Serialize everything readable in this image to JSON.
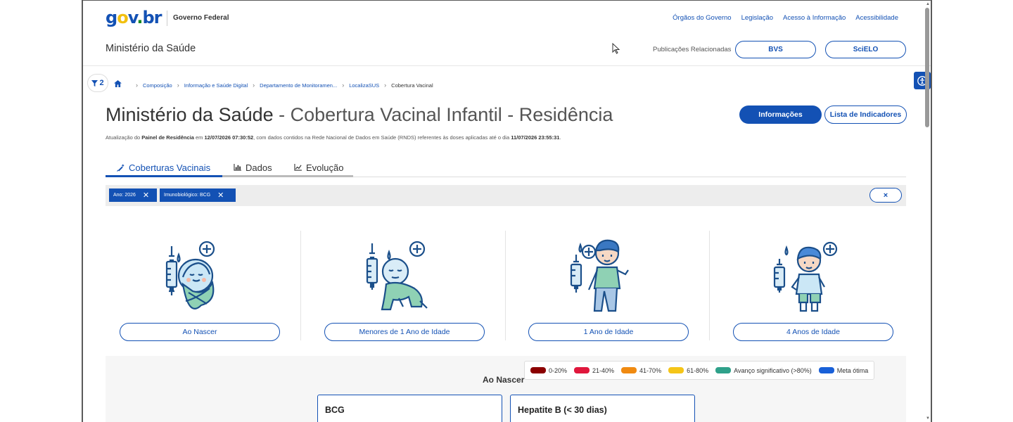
{
  "header": {
    "logo": {
      "g": "g",
      "o": "o",
      "v": "v",
      "dot": ".",
      "br": "br"
    },
    "gov_federal": "Governo Federal",
    "links": [
      "Órgãos do Governo",
      "Legislação",
      "Acesso à Informação",
      "Acessibilidade"
    ],
    "ministry": "Ministério da Saúde",
    "pub_label": "Publicações Relacionadas",
    "pill_bvs": "BVS",
    "pill_scielo": "SciELO"
  },
  "filter_badge": {
    "count": "2"
  },
  "breadcrumb": [
    "Composição",
    "Informação e Saúde Digital",
    "Departamento de Monitoramen...",
    "LocalizaSUS",
    "Cobertura Vacinal"
  ],
  "title": {
    "main": "Ministério da Saúde",
    "rest": " - Cobertura Vacinal Infantil - Residência"
  },
  "buttons": {
    "info": "Informações",
    "indicators": "Lista de Indicadores"
  },
  "update": {
    "p1": "Atualização do ",
    "panel": "Painel de Residência",
    "p2": " em ",
    "date1": "12/07/2026 07:30:52",
    "p3": ", com dados contidos na Rede Nacional de Dados em Saúde (RNDS) referentes às doses aplicadas até o dia ",
    "date2": "11/07/2026 23:55:31",
    "p4": "."
  },
  "tabs": [
    "Coberturas Vacinais",
    "Dados",
    "Evolução"
  ],
  "filters": {
    "chips": [
      "Ano: 2026",
      "Imunobiológico: BCG"
    ],
    "clear": "×"
  },
  "cards": [
    "Ao Nascer",
    "Menores de 1 Ano de Idade",
    "1 Ano de Idade",
    "4 Anos de Idade"
  ],
  "legend": [
    {
      "label": "0-20%",
      "color": "#8b0000"
    },
    {
      "label": "21-40%",
      "color": "#e0173c"
    },
    {
      "label": "41-70%",
      "color": "#f08a11"
    },
    {
      "label": "61-80%",
      "color": "#f5c518"
    },
    {
      "label": "Avanço significativo (>80%)",
      "color": "#2fa18a"
    },
    {
      "label": "Meta ótima",
      "color": "#1960d8"
    }
  ],
  "section_title": "Ao Nascer",
  "vaccines": [
    "BCG",
    "Hepatite B (< 30 dias)"
  ],
  "colors": {
    "primary": "#1351b4",
    "filterbar": "#ededed"
  }
}
